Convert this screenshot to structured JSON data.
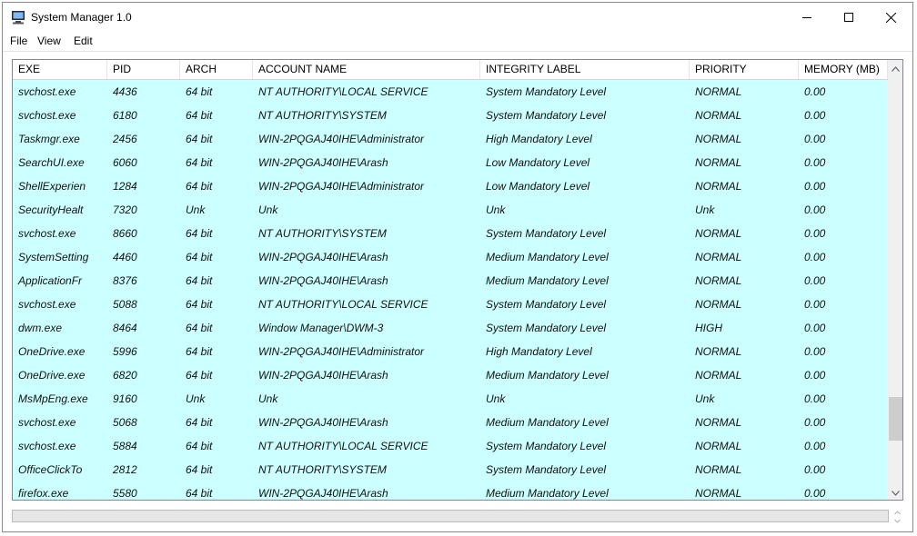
{
  "window": {
    "title": "System Manager 1.0"
  },
  "menu": [
    "File",
    "View",
    "Edit"
  ],
  "table": {
    "columns": [
      "EXE",
      "PID",
      "ARCH",
      "ACCOUNT NAME",
      "INTEGRITY LABEL",
      "PRIORITY",
      "MEMORY (MB)"
    ],
    "rows": [
      [
        "svchost.exe",
        "4436",
        "64 bit",
        "NT AUTHORITY\\LOCAL SERVICE",
        "System Mandatory Level",
        "NORMAL",
        "0.00"
      ],
      [
        "svchost.exe",
        "6180",
        "64 bit",
        "NT AUTHORITY\\SYSTEM",
        "System Mandatory Level",
        "NORMAL",
        "0.00"
      ],
      [
        "Taskmgr.exe",
        "2456",
        "64 bit",
        "WIN-2PQGAJ40IHE\\Administrator",
        "High Mandatory Level",
        "NORMAL",
        "0.00"
      ],
      [
        "SearchUI.exe",
        "6060",
        "64 bit",
        "WIN-2PQGAJ40IHE\\Arash",
        "Low Mandatory Level",
        "NORMAL",
        "0.00"
      ],
      [
        "ShellExperien",
        "1284",
        "64 bit",
        "WIN-2PQGAJ40IHE\\Administrator",
        "Low Mandatory Level",
        "NORMAL",
        "0.00"
      ],
      [
        "SecurityHealt",
        "7320",
        "Unk",
        "Unk",
        "Unk",
        "Unk",
        "0.00"
      ],
      [
        "svchost.exe",
        "8660",
        "64 bit",
        "NT AUTHORITY\\SYSTEM",
        "System Mandatory Level",
        "NORMAL",
        "0.00"
      ],
      [
        "SystemSetting",
        "4460",
        "64 bit",
        "WIN-2PQGAJ40IHE\\Arash",
        "Medium Mandatory Level",
        "NORMAL",
        "0.00"
      ],
      [
        "ApplicationFr",
        "8376",
        "64 bit",
        "WIN-2PQGAJ40IHE\\Arash",
        "Medium Mandatory Level",
        "NORMAL",
        "0.00"
      ],
      [
        "svchost.exe",
        "5088",
        "64 bit",
        "NT AUTHORITY\\LOCAL SERVICE",
        "System Mandatory Level",
        "NORMAL",
        "0.00"
      ],
      [
        "dwm.exe",
        "8464",
        "64 bit",
        "Window Manager\\DWM-3",
        "System Mandatory Level",
        "HIGH",
        "0.00"
      ],
      [
        "OneDrive.exe",
        "5996",
        "64 bit",
        "WIN-2PQGAJ40IHE\\Administrator",
        "High Mandatory Level",
        "NORMAL",
        "0.00"
      ],
      [
        "OneDrive.exe",
        "6820",
        "64 bit",
        "WIN-2PQGAJ40IHE\\Arash",
        "Medium Mandatory Level",
        "NORMAL",
        "0.00"
      ],
      [
        "MsMpEng.exe",
        "9160",
        "Unk",
        "Unk",
        "Unk",
        "Unk",
        "0.00"
      ],
      [
        "svchost.exe",
        "5068",
        "64 bit",
        "WIN-2PQGAJ40IHE\\Arash",
        "Medium Mandatory Level",
        "NORMAL",
        "0.00"
      ],
      [
        "svchost.exe",
        "5884",
        "64 bit",
        "NT AUTHORITY\\LOCAL SERVICE",
        "System Mandatory Level",
        "NORMAL",
        "0.00"
      ],
      [
        "OfficeClickTo",
        "2812",
        "64 bit",
        "NT AUTHORITY\\SYSTEM",
        "System Mandatory Level",
        "NORMAL",
        "0.00"
      ],
      [
        "firefox.exe",
        "5580",
        "64 bit",
        "WIN-2PQGAJ40IHE\\Arash",
        "Medium Mandatory Level",
        "NORMAL",
        "0.00"
      ]
    ]
  },
  "icons": {
    "app": "computer-icon",
    "minimize": "minimize-icon",
    "maximize": "maximize-icon",
    "close": "close-icon",
    "scroll_up": "chevron-up-icon",
    "scroll_down": "chevron-down-icon"
  },
  "colors": {
    "row_background": "#ccffff",
    "header_background": "#ffffff"
  }
}
